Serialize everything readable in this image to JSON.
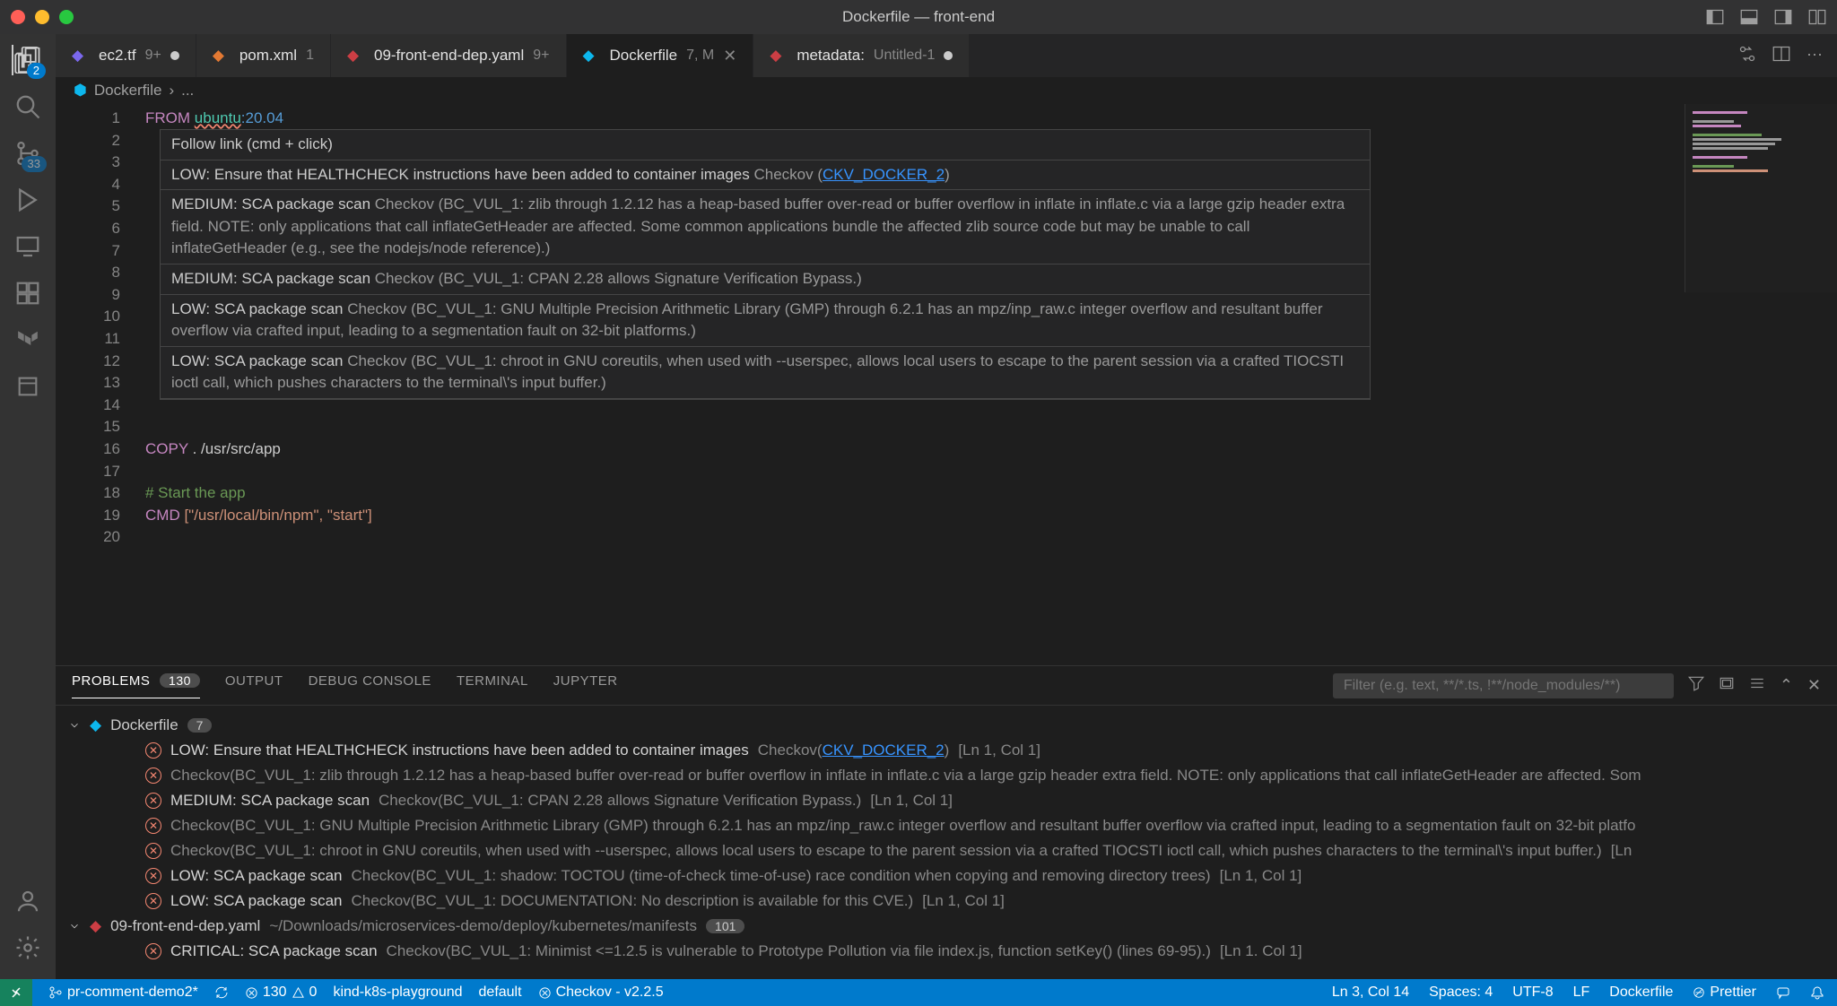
{
  "title_bar": {
    "title": "Dockerfile — front-end"
  },
  "activity_bar": {
    "explorer_badge": "2",
    "scm_badge": "33"
  },
  "tabs": [
    {
      "label": "ec2.tf",
      "badge": "9+",
      "dirty": true,
      "icon_color": "#7b68ee"
    },
    {
      "label": "pom.xml",
      "badge": "1",
      "dirty": false,
      "icon_color": "#e37933"
    },
    {
      "label": "09-front-end-dep.yaml",
      "badge": "9+",
      "dirty": false,
      "icon_color": "#cc3e44"
    },
    {
      "label": "Dockerfile",
      "badge": "7, M",
      "dirty": false,
      "active": true,
      "icon_color": "#0db7ed"
    },
    {
      "label": "metadata: ",
      "sublabel": "Untitled-1",
      "dirty": true,
      "icon_color": "#cc3e44"
    }
  ],
  "breadcrumb": {
    "file": "Dockerfile",
    "suffix": "..."
  },
  "code": {
    "lines": [
      {
        "n": 1,
        "html": "<span class='kw-from'>FROM</span> <span class='kw-cyan squiggle'>ubuntu</span><span class='kw-blue'>:20.04</span>"
      },
      {
        "n": 2,
        "html": ""
      },
      {
        "n": 3,
        "html": ""
      },
      {
        "n": 4,
        "html": ""
      },
      {
        "n": 5,
        "html": ""
      },
      {
        "n": 6,
        "html": ""
      },
      {
        "n": 7,
        "html": ""
      },
      {
        "n": 8,
        "html": ""
      },
      {
        "n": 9,
        "html": ""
      },
      {
        "n": 10,
        "html": ""
      },
      {
        "n": 11,
        "html": ""
      },
      {
        "n": 12,
        "html": ""
      },
      {
        "n": 13,
        "html": ""
      },
      {
        "n": 14,
        "html": ""
      },
      {
        "n": 15,
        "html": ""
      },
      {
        "n": 16,
        "html": "<span class='kw-copy'>COPY</span> . /usr/src/app"
      },
      {
        "n": 17,
        "html": ""
      },
      {
        "n": 18,
        "html": "<span class='kw-comment'># Start the app</span>"
      },
      {
        "n": 19,
        "html": "<span class='kw-copy'>CMD</span> <span class='kw-orange'>[\"/usr/local/bin/npm\", \"start\"]</span>"
      },
      {
        "n": 20,
        "html": ""
      }
    ]
  },
  "hover": {
    "header": "Follow link (cmd + click)",
    "items": [
      {
        "bold": "LOW: Ensure that HEALTHCHECK instructions have been added to container images",
        "gray": "Checkov (",
        "link": "CKV_DOCKER_2",
        "trail": ")"
      },
      {
        "bold": "MEDIUM: SCA package scan",
        "gray": "Checkov (BC_VUL_1: zlib through 1.2.12 has a heap-based buffer over-read or buffer overflow in inflate in inflate.c via a large gzip header extra field. NOTE: only applications that call inflateGetHeader are affected. Some common applications bundle the affected zlib source code but may be unable to call inflateGetHeader (e.g., see the nodejs/node reference).)"
      },
      {
        "bold": "MEDIUM: SCA package scan",
        "gray": "Checkov (BC_VUL_1: CPAN 2.28 allows Signature Verification Bypass.)"
      },
      {
        "bold": "LOW: SCA package scan",
        "gray": "Checkov (BC_VUL_1: GNU Multiple Precision Arithmetic Library (GMP) through 6.2.1 has an mpz/inp_raw.c integer overflow and resultant buffer overflow via crafted input, leading to a segmentation fault on 32-bit platforms.)"
      },
      {
        "bold": "LOW: SCA package scan",
        "gray": "Checkov (BC_VUL_1: chroot in GNU coreutils, when used with --userspec, allows local users to escape to the parent session via a crafted TIOCSTI ioctl call, which pushes characters to the terminal\\'s input buffer.)"
      }
    ]
  },
  "panel": {
    "tabs": [
      "PROBLEMS",
      "OUTPUT",
      "DEBUG CONSOLE",
      "TERMINAL",
      "JUPYTER"
    ],
    "problems_badge": "130",
    "filter_placeholder": "Filter (e.g. text, **/*.ts, !**/node_modules/**)",
    "groups": [
      {
        "file": "Dockerfile",
        "count": "7",
        "items": [
          {
            "text": "LOW: Ensure that HEALTHCHECK instructions have been added to container images",
            "src": "Checkov(",
            "link": "CKV_DOCKER_2",
            "trail": ")",
            "loc": "[Ln 1, Col 1]"
          },
          {
            "text": "",
            "src": "Checkov(BC_VUL_1: zlib through 1.2.12 has a heap-based buffer over-read or buffer overflow in inflate in inflate.c via a large gzip header extra field. NOTE: only applications that call inflateGetHeader are affected. Som",
            "loc": ""
          },
          {
            "text": "MEDIUM: SCA package scan",
            "src": "Checkov(BC_VUL_1: CPAN 2.28 allows Signature Verification Bypass.)",
            "loc": "[Ln 1, Col 1]"
          },
          {
            "text": "",
            "src": "Checkov(BC_VUL_1: GNU Multiple Precision Arithmetic Library (GMP) through 6.2.1 has an mpz/inp_raw.c integer overflow and resultant buffer overflow via crafted input, leading to a segmentation fault on 32-bit platfo",
            "loc": ""
          },
          {
            "text": "",
            "src": "Checkov(BC_VUL_1: chroot in GNU coreutils, when used with --userspec, allows local users to escape to the parent session via a crafted TIOCSTI ioctl call, which pushes characters to the terminal\\'s input buffer.)",
            "loc": "[Ln"
          },
          {
            "text": "LOW: SCA package scan",
            "src": "Checkov(BC_VUL_1: shadow: TOCTOU (time-of-check time-of-use) race condition when copying and removing directory trees)",
            "loc": "[Ln 1, Col 1]"
          },
          {
            "text": "LOW: SCA package scan",
            "src": "Checkov(BC_VUL_1: DOCUMENTATION: No description is available for this CVE.)",
            "loc": "[Ln 1, Col 1]"
          }
        ]
      },
      {
        "file": "09-front-end-dep.yaml",
        "path": "~/Downloads/microservices-demo/deploy/kubernetes/manifests",
        "count": "101",
        "items": [
          {
            "text": "CRITICAL: SCA package scan",
            "src": "Checkov(BC_VUL_1: Minimist <=1.2.5 is vulnerable to Prototype Pollution via file index.js, function setKey() (lines 69-95).)",
            "loc": "[Ln 1. Col 1]"
          }
        ]
      }
    ]
  },
  "status_bar": {
    "branch": "pr-comment-demo2*",
    "errors": "130",
    "warnings": "0",
    "context": "kind-k8s-playground",
    "namespace": "default",
    "checkov": "Checkov - v2.2.5",
    "position": "Ln 3, Col 14",
    "spaces": "Spaces: 4",
    "encoding": "UTF-8",
    "eol": "LF",
    "lang": "Dockerfile",
    "prettier": "Prettier"
  }
}
